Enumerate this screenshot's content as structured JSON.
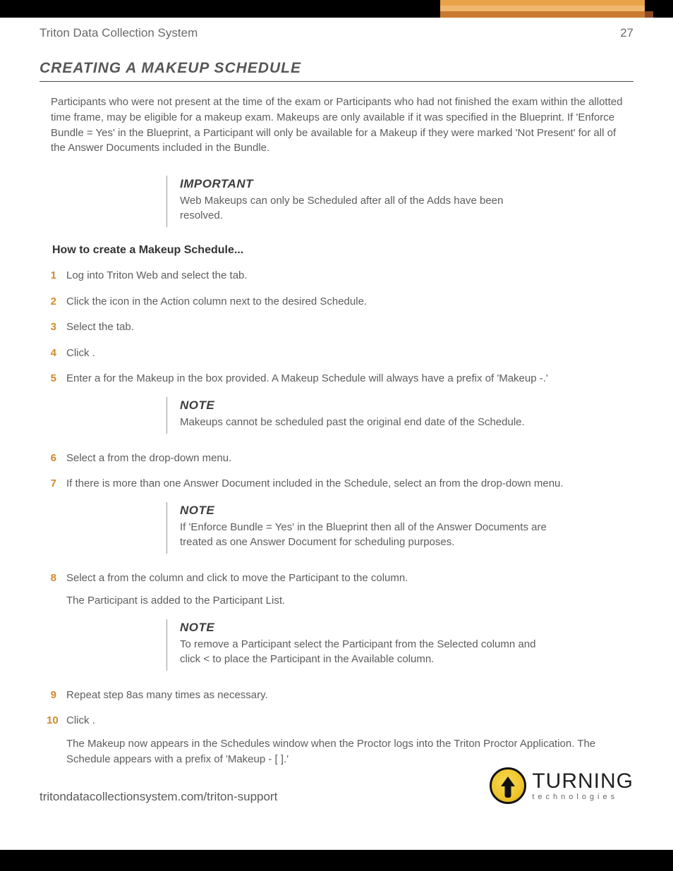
{
  "header": {
    "doc_title": "Triton Data Collection System",
    "page_number": "27"
  },
  "section_title": "CREATING A MAKEUP SCHEDULE",
  "intro": "Participants who were not present at the time of the exam or Participants who had not finished the exam within the allotted time frame, may be eligible for a makeup exam. Makeups are only available if it was specified in the Blueprint. If 'Enforce Bundle = Yes' in the Blueprint, a Participant will only be available for a Makeup if they were marked 'Not Present' for all of the Answer Documents included in the Bundle.",
  "important": {
    "label": "IMPORTANT",
    "body": "Web Makeups can only be Scheduled after all of the Adds have been resolved."
  },
  "howto_title": "How to create a Makeup Schedule...",
  "steps": {
    "s1": {
      "num": "1",
      "text": "Log into Triton Web and select the                     tab."
    },
    "s2": {
      "num": "2",
      "text": "Click the               icon in the Action column next to the desired Schedule."
    },
    "s3": {
      "num": "3",
      "text": "Select the                  tab."
    },
    "s4": {
      "num": "4",
      "text": "Click           ."
    },
    "s5": {
      "num": "5",
      "text": "Enter a          for the Makeup in the box provided. A Makeup Schedule will always have a prefix of 'Makeup -.'"
    },
    "s6": {
      "num": "6",
      "text": "Select a             from the             drop-down menu."
    },
    "s7": {
      "num": "7",
      "text": "If there is more than one Answer Document included in the Schedule, select an                                   from the drop-down menu."
    },
    "s8": {
      "num": "8",
      "text": "Select a                   from the                 column and click    to move the Participant to the                 column.",
      "sub": "The Participant is added to the Participant List."
    },
    "s9": {
      "num": "9",
      "text": "Repeat step 8as many times as necessary."
    },
    "s10": {
      "num": "10",
      "text": "Click          .",
      "sub": "The Makeup now appears in the Schedules window when the Proctor logs into the Triton Proctor Application. The Schedule appears with a prefix of 'Makeup - [                               ].'"
    }
  },
  "note1": {
    "label": "NOTE",
    "body": "Makeups cannot be scheduled past the original end date of the Schedule."
  },
  "note2": {
    "label": "NOTE",
    "body": "If 'Enforce Bundle = Yes' in the Blueprint then all of the Answer Documents are treated as one Answer Document for scheduling purposes."
  },
  "note3": {
    "label": "NOTE",
    "body": "To remove a Participant select the Participant from the Selected column and click < to place the Participant in the Available column."
  },
  "footer": {
    "url": "tritondatacollectionsystem.com/triton-support",
    "logo_main": "TURNING",
    "logo_sub": "technologies"
  }
}
